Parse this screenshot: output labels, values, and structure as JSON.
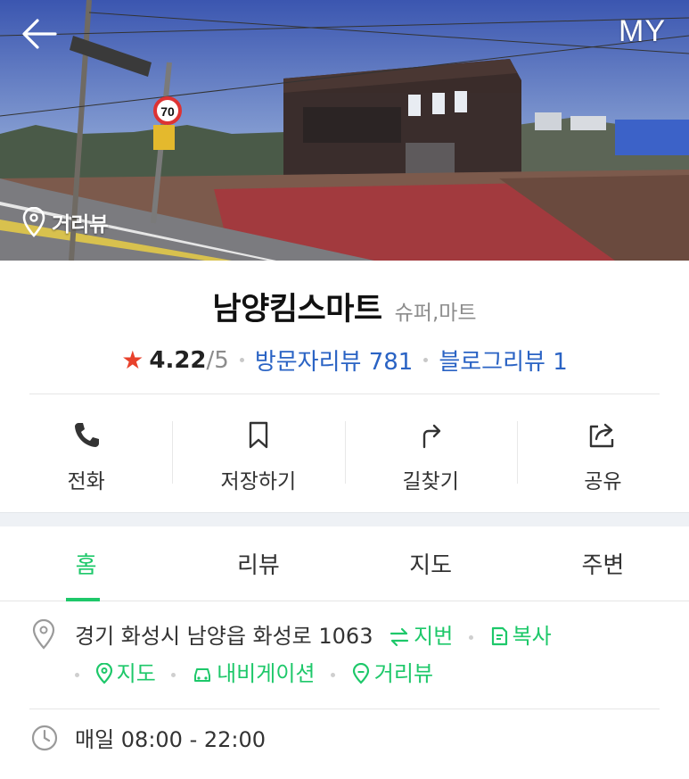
{
  "nav": {
    "back_icon": "back-arrow-icon",
    "my_label": "MY"
  },
  "hero": {
    "street_view_label": "거리뷰",
    "speed_sign": "70"
  },
  "place": {
    "name": "남양킴스마트",
    "category": "슈퍼,마트",
    "rating": "4.22",
    "rating_max": "/5",
    "visitor_review": "방문자리뷰 781",
    "blog_review": "블로그리뷰 1"
  },
  "actions": [
    {
      "label": "전화",
      "icon": "phone-icon"
    },
    {
      "label": "저장하기",
      "icon": "bookmark-icon"
    },
    {
      "label": "길찾기",
      "icon": "directions-icon"
    },
    {
      "label": "공유",
      "icon": "share-icon"
    }
  ],
  "tabs": [
    {
      "label": "홈",
      "active": true
    },
    {
      "label": "리뷰"
    },
    {
      "label": "지도"
    },
    {
      "label": "주변"
    }
  ],
  "info": {
    "address": "경기 화성시 남양읍 화성로 1063",
    "lot_number": "지번",
    "copy": "복사",
    "map": "지도",
    "navigation": "내비게이션",
    "street_view": "거리뷰",
    "hours": "매일 08:00 - 22:00"
  },
  "colors": {
    "accent_green": "#1ec86a",
    "link_blue": "#2a63c4",
    "star_red": "#e8412b"
  }
}
